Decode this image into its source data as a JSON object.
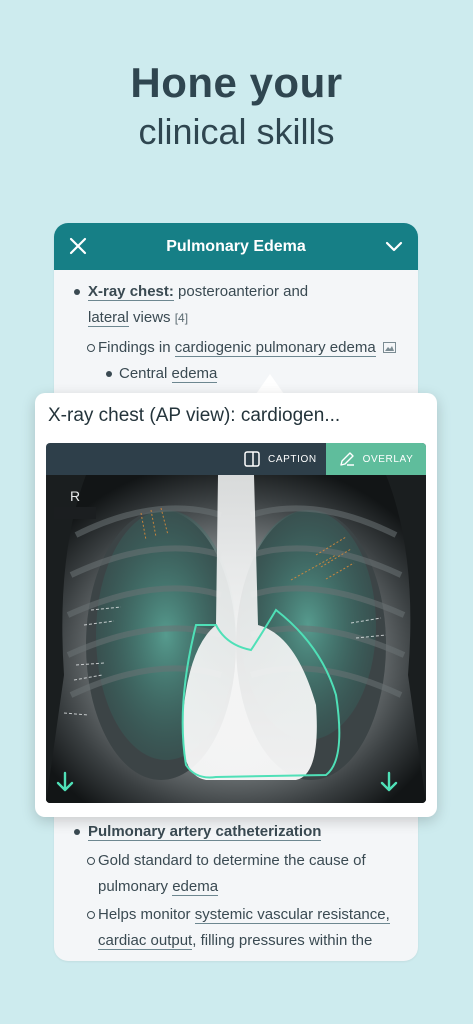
{
  "headline": {
    "line1": "Hone your",
    "line2": "clinical skills"
  },
  "card": {
    "title": "Pulmonary Edema",
    "items": {
      "xray_bold": "X-ray chest:",
      "xray_text1": "posteroanterior and",
      "xray_link": "lateral",
      "xray_text2": "views",
      "xray_ref": "[4]",
      "findings_text": "Findings in",
      "findings_link": "cardiogenic pulmonary edema",
      "central_text": "Central",
      "central_link": "edema",
      "pac_bold": "Pulmonary artery catheterization",
      "gold_line1": "Gold standard to determine the cause of",
      "gold_line2a": "pulmonary",
      "gold_link": "edema",
      "helps_text": "Helps monitor",
      "helps_link1": "systemic vascular resistance,",
      "helps_link2": "cardiac output",
      "helps_text2": ", filling pressures within the"
    }
  },
  "popup": {
    "title": "X-ray chest (AP view): cardiogen...",
    "caption_label": "CAPTION",
    "overlay_label": "OVERLAY",
    "marker_label": "R"
  },
  "colors": {
    "accent": "#167f86",
    "overlay_active": "#5fbd9c",
    "background": "#cdebee"
  }
}
